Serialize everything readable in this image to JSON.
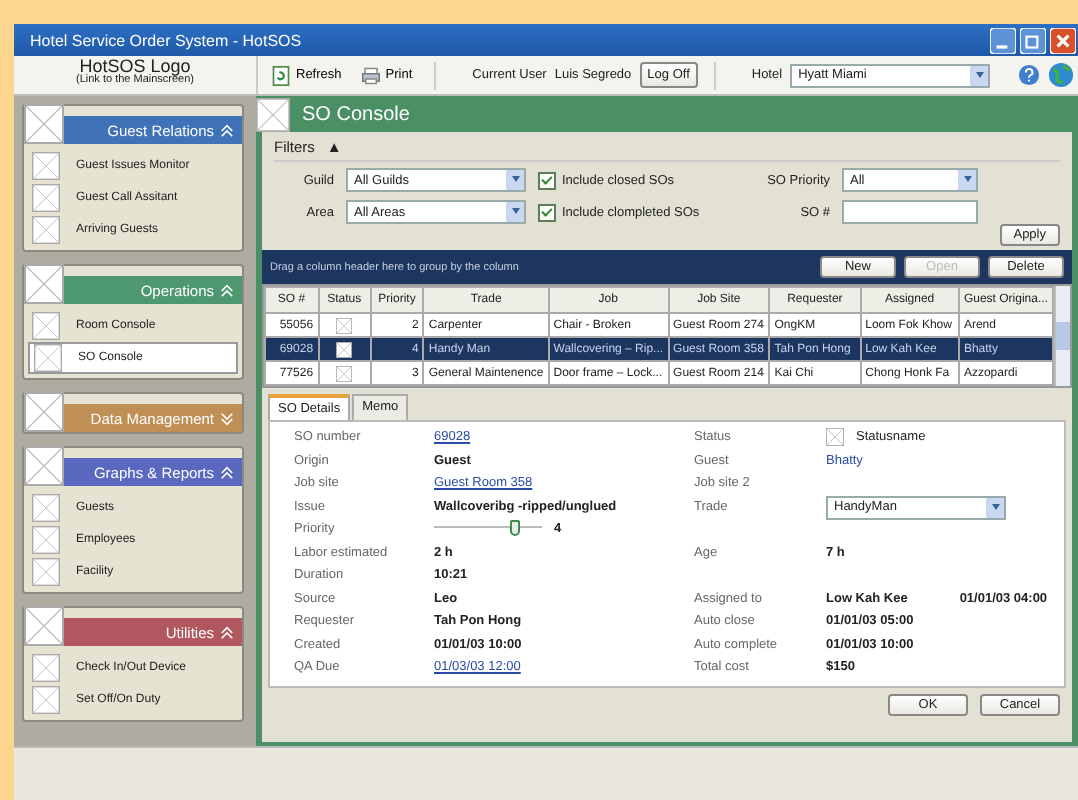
{
  "window": {
    "title": "Hotel Service Order System - HotSOS"
  },
  "logo": {
    "title": "HotSOS Logo",
    "subtitle": "(Link to the Mainscreen)"
  },
  "toolbar": {
    "buttons": [
      {
        "label": "Refresh",
        "kind": "refresh"
      },
      {
        "label": "Print",
        "kind": "print"
      }
    ],
    "user_label": "Current User",
    "user_name": "Luis Segredo",
    "logoff": "Log Off",
    "hotel_label": "Hotel",
    "hotel_value": "Hyatt Miami"
  },
  "sidebar": {
    "sections": [
      {
        "title": "Guest Relations",
        "color": "#3f72b6",
        "expanded": true,
        "items": [
          {
            "label": "Guest Issues Monitor",
            "selected": false
          },
          {
            "label": "Guest Call Assitant",
            "selected": false
          },
          {
            "label": "Arriving Guests",
            "selected": false
          }
        ]
      },
      {
        "title": "Operations",
        "color": "#4e9870",
        "expanded": true,
        "items": [
          {
            "label": "Room Console",
            "selected": false
          },
          {
            "label": "SO Console",
            "selected": true
          }
        ]
      },
      {
        "title": "Data Management",
        "color": "#bf8f55",
        "expanded": false
      },
      {
        "title": "Graphs & Reports",
        "color": "#5a68c0",
        "expanded": true,
        "items": [
          {
            "label": "Guests",
            "selected": false
          },
          {
            "label": "Employees",
            "selected": false
          },
          {
            "label": "Facility",
            "selected": false
          }
        ]
      },
      {
        "title": "Utilities",
        "color": "#b0575f",
        "expanded": true,
        "items": [
          {
            "label": "Check In/Out Device",
            "selected": false
          },
          {
            "label": "Set Off/On Duty",
            "selected": false
          }
        ]
      }
    ]
  },
  "console": {
    "title": "SO Console",
    "filters": {
      "title": "Filters",
      "toggle": "▲",
      "guild_label": "Guild",
      "guild_value": "All Guilds",
      "area_label": "Area",
      "area_value": "All Areas",
      "checks": [
        {
          "label": "Include closed SOs",
          "checked": true
        },
        {
          "label": "Include clompleted SOs",
          "checked": true
        }
      ],
      "priority_label": "SO Priority",
      "priority_value": "All",
      "so_label": "SO #",
      "apply": "Apply"
    },
    "grid": {
      "group_hint": "Drag a column header here to group by the column",
      "buttons": [
        {
          "label": "New",
          "disabled": false
        },
        {
          "label": "Open",
          "disabled": true
        },
        {
          "label": "Delete",
          "disabled": false
        }
      ],
      "columns": [
        "SO #",
        "Status",
        "Priority",
        "Trade",
        "Job",
        "Job Site",
        "Requester",
        "Assigned",
        "Guest Origina..."
      ],
      "rows": [
        {
          "selected": false,
          "so": "55056",
          "priority": "2",
          "trade": "Carpenter",
          "job": "Chair - Broken",
          "site": "Guest Room 274",
          "requester": "OngKM",
          "assigned": "Loom Fok Khow",
          "guest": "Arend"
        },
        {
          "selected": true,
          "so": "69028",
          "priority": "4",
          "trade": "Handy Man",
          "job": "Wallcovering – Rip...",
          "site": "Guest Room 358",
          "requester": "Tah Pon Hong",
          "assigned": "Low Kah Kee",
          "guest": "Bhatty"
        },
        {
          "selected": false,
          "so": "77526",
          "priority": "3",
          "trade": "General Maintenence",
          "job": "Door frame – Lock...",
          "site": "Guest Room 214",
          "requester": "Kai Chi",
          "assigned": "Chong Honk Fa",
          "guest": "Azzopardi"
        }
      ]
    },
    "tabs": [
      {
        "label": "SO Details",
        "selected": true
      },
      {
        "label": "Memo",
        "selected": false
      }
    ],
    "details": [
      {
        "left": {
          "label": "SO number",
          "value": "69028",
          "kind": "link"
        },
        "right": {
          "label": "Status",
          "value": "Statusname",
          "kind": "status"
        }
      },
      {
        "left": {
          "label": "Origin",
          "value": "Guest",
          "kind": "text"
        },
        "right": {
          "label": "Guest",
          "value": "Bhatty",
          "kind": "name"
        }
      },
      {
        "left": {
          "label": "Job site",
          "value": "Guest Room 358",
          "kind": "link"
        },
        "right": {
          "label": "Job site 2",
          "kind": "text"
        }
      },
      {
        "left": {
          "label": "Issue",
          "value": "Wallcoveribg -ripped/unglued",
          "kind": "text"
        },
        "right": {
          "label": "Trade",
          "value": "HandyMan",
          "kind": "select"
        }
      },
      {
        "left": {
          "label": "Priority",
          "value": "4",
          "kind": "slider",
          "level": 0.75
        }
      },
      {
        "left": {
          "label": "Labor estimated",
          "value": "2 h",
          "kind": "text"
        },
        "right": {
          "label": "Age",
          "value": "7 h",
          "kind": "text"
        }
      },
      {
        "left": {
          "label": "Duration",
          "value": "10:21",
          "kind": "text"
        }
      },
      {
        "left": {
          "label": "Source",
          "value": "Leo",
          "kind": "text"
        },
        "right": {
          "label": "Assigned to",
          "value": "Low Kah Kee",
          "extra": "01/01/03 04:00",
          "kind": "text"
        }
      },
      {
        "left": {
          "label": "Requester",
          "value": "Tah Pon Hong",
          "kind": "text"
        },
        "right": {
          "label": "Auto close",
          "value": "01/01/03 05:00",
          "kind": "text"
        }
      },
      {
        "left": {
          "label": "Created",
          "value": "01/01/03 10:00",
          "kind": "text"
        },
        "right": {
          "label": "Auto complete",
          "value": "01/01/03 10:00",
          "kind": "text"
        }
      },
      {
        "left": {
          "label": "QA Due",
          "value": "01/03/03 12:00",
          "kind": "link"
        },
        "right": {
          "label": "Total cost",
          "value": "$150",
          "kind": "text"
        }
      }
    ],
    "buttons": [
      "OK",
      "Cancel"
    ]
  }
}
